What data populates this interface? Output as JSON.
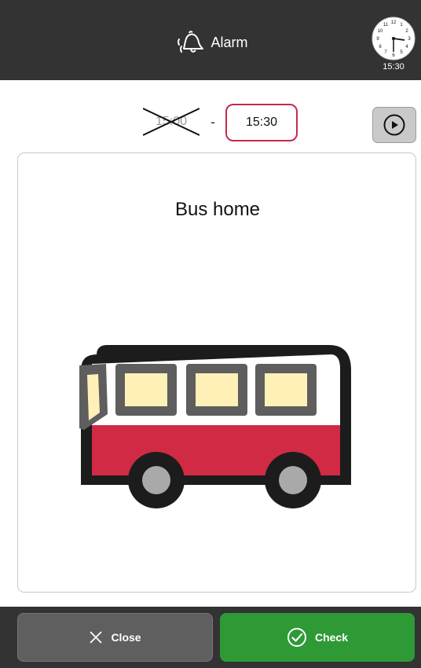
{
  "header": {
    "title": "Alarm",
    "title_icon": "bell-icon",
    "clock": {
      "time": "15:30",
      "icon": "analog-clock-icon"
    }
  },
  "time_range": {
    "old_time": "15:00",
    "old_time_struck": true,
    "separator": "-",
    "new_time": "15:30",
    "play_icon": "play-icon"
  },
  "card": {
    "title": "Bus home",
    "image": "bus-illustration"
  },
  "footer": {
    "close_label": "Close",
    "close_icon": "x-icon",
    "check_label": "Check",
    "check_icon": "check-circle-icon"
  },
  "colors": {
    "header_bg": "#333333",
    "accent_red": "#c62a4b",
    "check_green": "#2e9a36",
    "close_gray": "#5f5f5f",
    "bus_red": "#d12a44",
    "bus_window": "#fff0b8"
  }
}
